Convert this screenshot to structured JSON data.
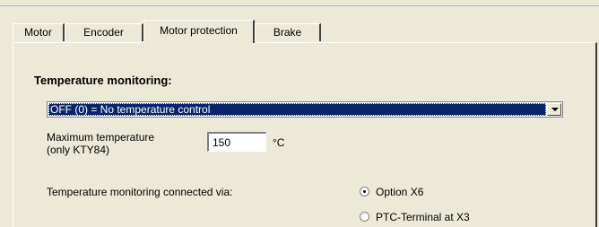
{
  "tabs": [
    {
      "label": "Motor",
      "active": false
    },
    {
      "label": "Encoder",
      "active": false
    },
    {
      "label": "Motor protection",
      "active": true
    },
    {
      "label": "Brake",
      "active": false
    }
  ],
  "temperature_monitoring": {
    "title": "Temperature monitoring:",
    "mode_selected": "OFF (0) = No temperature control",
    "max_temp_label_line1": "Maximum temperature",
    "max_temp_label_line2": "(only KTY84)",
    "max_temp_value": "150",
    "max_temp_unit": "°C",
    "connected_via_label": "Temperature monitoring connected via:",
    "options": [
      {
        "label": "Option X6",
        "selected": true
      },
      {
        "label": "PTC-Terminal at X3",
        "selected": false
      }
    ]
  },
  "colors": {
    "dialog_bg": "#ece9d8",
    "selection_bg": "#0a246a",
    "selection_text": "#ffffff"
  }
}
